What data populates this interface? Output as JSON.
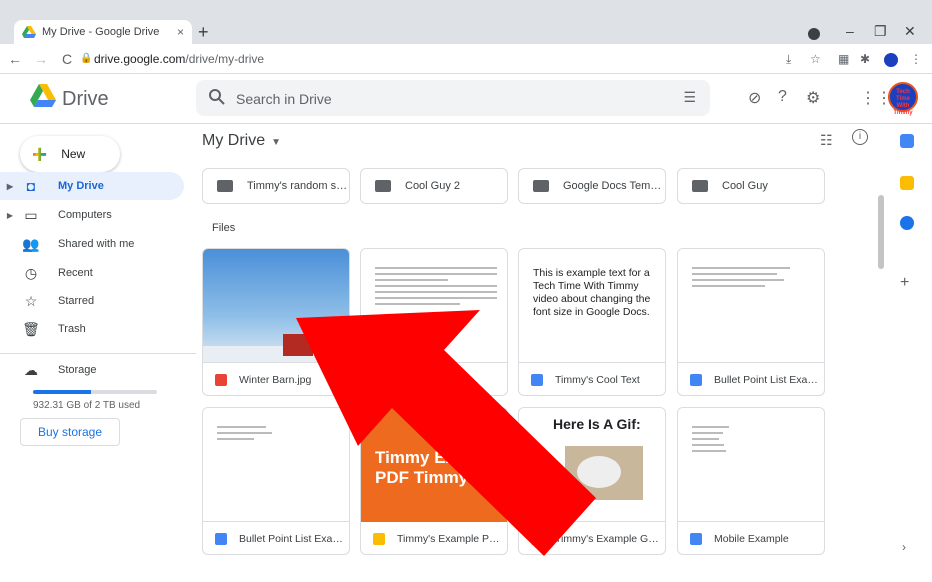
{
  "browser": {
    "tab_title": "My Drive - Google Drive",
    "tab_close": "×",
    "new_tab": "+",
    "url_host": "drive.google.com",
    "url_path": "/drive/my-drive",
    "back": "←",
    "forward": "→",
    "reload": "C",
    "window_controls": {
      "minimize": "–",
      "restore": "❐",
      "close": "✕"
    }
  },
  "header": {
    "brand": "Drive",
    "search_placeholder": "Search in Drive",
    "icons": [
      "tune-icon",
      "offline-icon",
      "help-icon",
      "settings-icon",
      "apps-icon"
    ]
  },
  "avatar_text": "Tech Time With Timmy",
  "sidebar": {
    "new_label": "New",
    "items": [
      {
        "label": "My Drive",
        "icon": "drive-icon",
        "active": true,
        "caret": true
      },
      {
        "label": "Computers",
        "icon": "computer-icon",
        "active": false,
        "caret": true
      },
      {
        "label": "Shared with me",
        "icon": "people-icon",
        "active": false,
        "caret": false
      },
      {
        "label": "Recent",
        "icon": "clock-icon",
        "active": false,
        "caret": false
      },
      {
        "label": "Starred",
        "icon": "star-icon",
        "active": false,
        "caret": false
      },
      {
        "label": "Trash",
        "icon": "trash-icon",
        "active": false,
        "caret": false
      }
    ],
    "storage_label": "Storage",
    "storage_used_fraction": 0.47,
    "storage_text": "932.31 GB of 2 TB used",
    "buy_storage": "Buy storage"
  },
  "main": {
    "title": "My Drive",
    "folders": [
      "Timmy's random stoc...",
      "Cool Guy 2",
      "Google Docs Templat...",
      "Cool Guy"
    ],
    "files_label": "Files",
    "files": [
      {
        "name": "Winter Barn.jpg",
        "type": "image",
        "color": "#ea4335"
      },
      {
        "name": "",
        "type": "doc",
        "color": "#4285f4"
      },
      {
        "name": "Timmy's Cool Text",
        "type": "doc",
        "color": "#4285f4"
      },
      {
        "name": "Bullet Point List Exam...",
        "type": "doc",
        "color": "#4285f4"
      },
      {
        "name": "Bullet Point List Exam...",
        "type": "doc",
        "color": "#4285f4"
      },
      {
        "name": "Timmy's Example PD...",
        "type": "slides",
        "color": "#fbbc04"
      },
      {
        "name": "Timmy's Example Gif ...",
        "type": "slides",
        "color": "#fbbc04"
      },
      {
        "name": "Mobile Example",
        "type": "doc",
        "color": "#4285f4"
      }
    ],
    "preview_text": {
      "cool_text": "This is example text for a Tech Time With Timmy video about changing the font size in Google Docs.",
      "pdf": "Timmy Example PDF Timmy",
      "gif_title": "Here Is A Gif:"
    }
  },
  "colors": {
    "accent": "#1a73e8",
    "arrow": "#ff0000"
  }
}
